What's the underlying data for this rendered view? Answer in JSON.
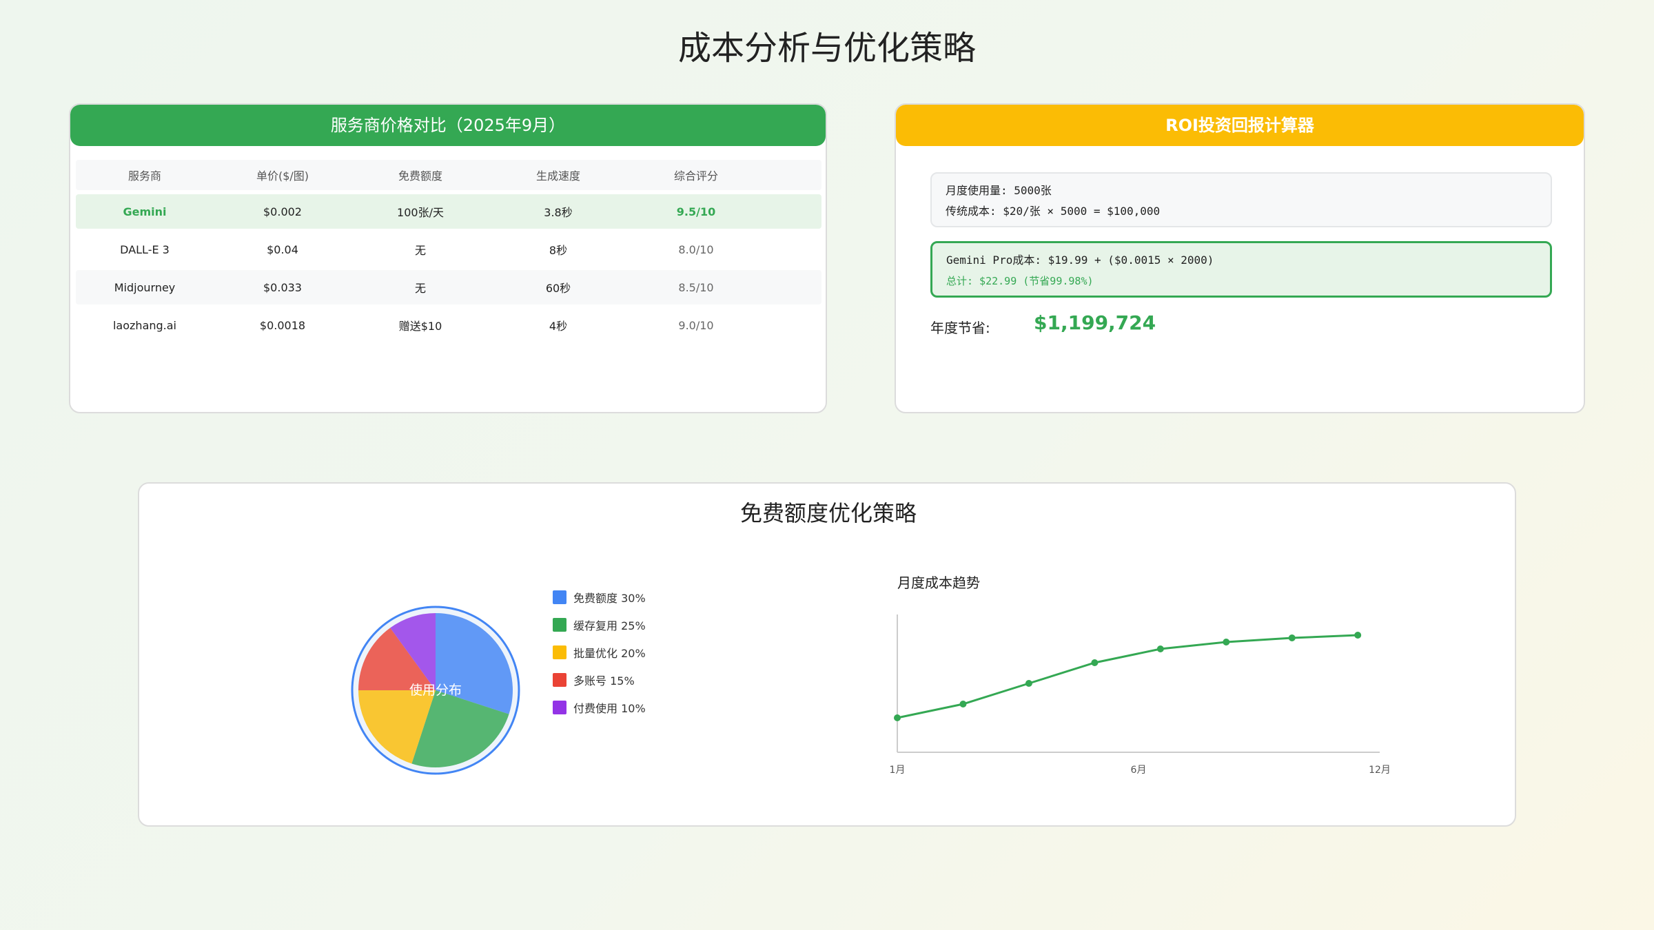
{
  "page": {
    "title": "成本分析与优化策略"
  },
  "price_table": {
    "title": "服务商价格对比（2025年9月）",
    "columns": [
      "服务商",
      "单价($/图)",
      "免费额度",
      "生成速度",
      "综合评分"
    ],
    "rows": [
      [
        "Gemini",
        "$0.002",
        "100张/天",
        "3.8秒",
        "9.5/10"
      ],
      [
        "DALL-E 3",
        "$0.04",
        "无",
        "8秒",
        "8.0/10"
      ],
      [
        "Midjourney",
        "$0.033",
        "无",
        "60秒",
        "8.5/10"
      ],
      [
        "laozhang.ai",
        "$0.0018",
        "赠送$10",
        "4秒",
        "9.0/10"
      ]
    ]
  },
  "roi": {
    "title": "ROI投资回报计算器",
    "box1_line1": "月度使用量: 5000张",
    "box1_line2": "传统成本: $20/张 × 5000 = $100,000",
    "box2_line1": "Gemini Pro成本: $19.99 + ($0.0015 × 2000)",
    "box2_line2": "总计: $22.99 (节省99.98%)",
    "savings_label": "年度节省:",
    "savings_value": "$1,199,724"
  },
  "strategy": {
    "title": "免费额度优化策略"
  },
  "chart_data": [
    {
      "type": "pie",
      "center_label": "使用分布",
      "slices": [
        {
          "label": "免费额度",
          "value": 30,
          "legend": "免费额度 30%",
          "color": "#4285f4"
        },
        {
          "label": "缓存复用",
          "value": 25,
          "legend": "缓存复用 25%",
          "color": "#34a853"
        },
        {
          "label": "批量优化",
          "value": 20,
          "legend": "批量优化 20%",
          "color": "#fbbc05"
        },
        {
          "label": "多账号",
          "value": 15,
          "legend": "多账号 15%",
          "color": "#ea4335"
        },
        {
          "label": "付费使用",
          "value": 10,
          "legend": "付费使用 10%",
          "color": "#9334e6"
        }
      ]
    },
    {
      "type": "line",
      "title": "月度成本趋势",
      "color": "#34a853",
      "x_tick_labels": [
        "1月",
        "6月",
        "12月"
      ],
      "x_tick_positions": [
        1,
        6.5,
        12
      ],
      "x": [
        1,
        2.5,
        4,
        5.5,
        7,
        8.5,
        10,
        11.5
      ],
      "y": [
        0.25,
        0.35,
        0.5,
        0.65,
        0.75,
        0.8,
        0.83,
        0.85
      ],
      "xlim": [
        1,
        12
      ],
      "ylim": [
        0,
        1
      ],
      "grid": false
    }
  ]
}
